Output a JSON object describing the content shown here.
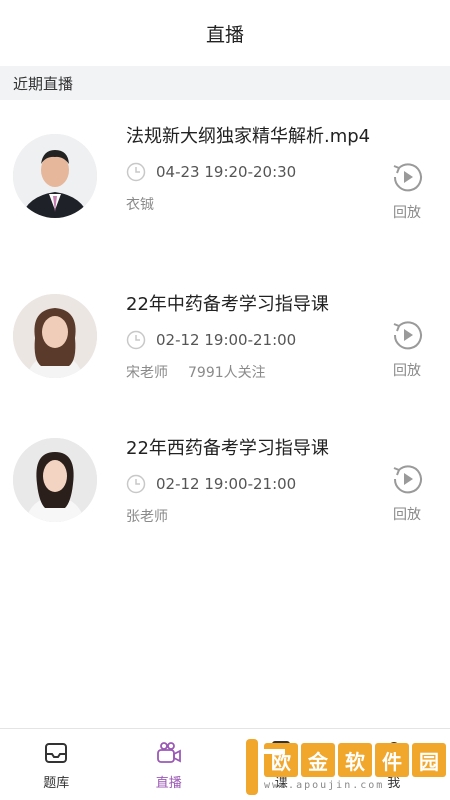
{
  "header": {
    "title": "直播"
  },
  "section": {
    "label": "近期直播"
  },
  "items": [
    {
      "title": "法规新大纲独家精华解析.mp4",
      "time": "04-23 19:20-20:30",
      "teacher": "衣铖",
      "followers": "",
      "replay_label": "回放"
    },
    {
      "title": "22年中药备考学习指导课",
      "time": "02-12 19:00-21:00",
      "teacher": "宋老师",
      "followers": "7991人关注",
      "replay_label": "回放"
    },
    {
      "title": "22年西药备考学习指导课",
      "time": "02-12 19:00-21:00",
      "teacher": "张老师",
      "followers": "",
      "replay_label": "回放"
    }
  ],
  "tabbar": {
    "tabs": [
      {
        "label": "题库",
        "icon": "inbox-icon",
        "active": false
      },
      {
        "label": "直播",
        "icon": "video-camera-icon",
        "active": true
      },
      {
        "label": "课",
        "icon": "document-icon",
        "active": false
      },
      {
        "label": "我",
        "icon": "user-icon",
        "active": false
      }
    ]
  },
  "watermark": {
    "text": "欧金软件园",
    "url": "www.apoujin.com"
  },
  "colors": {
    "accent": "#9b59b6",
    "section_bg": "#f2f3f5",
    "watermark": "#f1a62c"
  }
}
